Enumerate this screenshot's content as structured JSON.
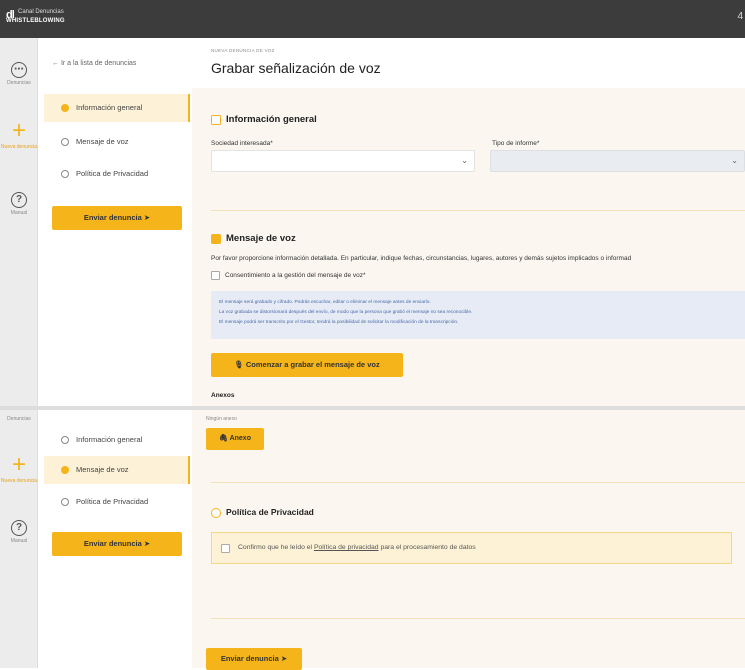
{
  "app": {
    "logo_mark": "dl",
    "logo_line1": "Canal Denuncias",
    "logo_line2": "WHISTLEBLOWING",
    "corner_glyph": "4"
  },
  "rail": {
    "items": [
      {
        "label": "Denuncias",
        "icon": "chat-icon"
      },
      {
        "label": "Nueva denuncia",
        "icon": "plus-icon"
      },
      {
        "label": "Manual",
        "icon": "help-icon"
      }
    ]
  },
  "nav": {
    "back_label": "← Ir a la lista de denuncias",
    "steps": [
      {
        "label": "Información general"
      },
      {
        "label": "Mensaje de voz"
      },
      {
        "label": "Política de Privacidad"
      }
    ],
    "send_label": "Enviar denuncia"
  },
  "page": {
    "breadcrumb": "NUEVA DENUNCIA DE VOZ",
    "title": "Grabar señalización de voz"
  },
  "general": {
    "title": "Información general",
    "company_label": "Sociedad interesada*",
    "company_value": "",
    "report_type_label": "Tipo de informe*",
    "report_type_value": ""
  },
  "voice": {
    "title": "Mensaje de voz",
    "description": "Por favor proporcione información detallada. En particular, indique fechas, circunstancias, lugares, autores y demás sujetos implicados o informad",
    "consent_label": "Consentimiento a la gestión del mensaje de voz*",
    "info_lines": [
      "El mensaje será grabado y cifrado. Podrás escuchar, editar o eliminar el mensaje antes de enviarlo.",
      "La voz grabada se distorsionará después del envío, de modo que la persona que grabó el mensaje no sea reconocible.",
      "El mensaje podrá ser transcrito por el Gestor, tendrá la posibilidad de solicitar la modificación de la transcripción."
    ],
    "record_button": "Comenzar a grabar el mensaje de voz",
    "attachments_label": "Anexos",
    "attachments_none": "Ningún anexo",
    "attachments_button": "Anexo"
  },
  "privacy": {
    "title": "Política de Privacidad",
    "consent_prefix": "Confirmo que he leído el ",
    "consent_link": "Política de privacidad",
    "consent_suffix": " para el procesamiento de datos"
  },
  "footer": {
    "send_label": "Enviar denuncia"
  },
  "colors": {
    "accent": "#f4b41a",
    "topbar": "#3c3c3c",
    "info_bg": "#e6ebf5",
    "info_text": "#4a6aaa"
  }
}
